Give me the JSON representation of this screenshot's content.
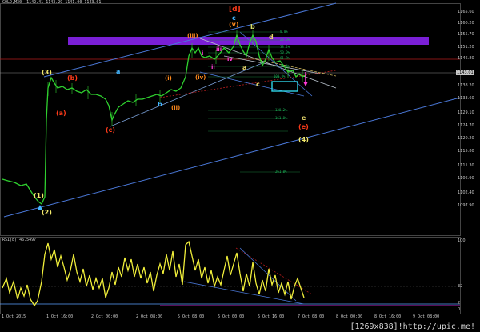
{
  "header": {
    "symbol": "GOLD,M30",
    "ohlc": "1142.41 1143.29 1141.00 1143.01"
  },
  "rsi_header": "RSI(8) 46.5497",
  "price_axis": [
    "1165.60",
    "1160.20",
    "1155.70",
    "1151.20",
    "1146.80",
    "1143.01",
    "1138.20",
    "1133.60",
    "1129.10",
    "1124.70",
    "1120.20",
    "1115.80",
    "1111.30",
    "1106.90",
    "1102.40",
    "1097.90"
  ],
  "rsi_axis": [
    "100",
    "32",
    "2",
    "0"
  ],
  "time_axis": [
    "1 Oct 2015",
    "1 Oct 16:00",
    "2 Oct 00:00",
    "2 Oct 08:00",
    "5 Oct 08:00",
    "6 Oct 00:00",
    "6 Oct 16:00",
    "7 Oct 08:00",
    "8 Oct 00:00",
    "8 Oct 16:00",
    "9 Oct 08:00"
  ],
  "waves": {
    "d_bracket": "[d]",
    "c_top": "c",
    "v": "(v)",
    "b_top": "b",
    "d": "d",
    "iii": "(iii)",
    "iii_sub": "iii",
    "i_sub": "i",
    "ii_sub": "ii",
    "iv_sub": "iv",
    "a_top": "a",
    "i_paren": "(i)",
    "iv_paren": "(iv)",
    "ii_paren": "(ii)",
    "b_blue": "b",
    "a_khaki": "a",
    "c_khaki": "c",
    "three": "(3)",
    "b_paren": "(b)",
    "a_paren": "(a)",
    "c_paren": "(c)",
    "e_khaki": "e",
    "e_red": "(e)",
    "four": "(4)",
    "one": "(1)",
    "two": "(2)",
    "a_blue": "a"
  },
  "fib_labels": [
    "0.0%",
    "23.6%",
    "38.2%",
    "50.0%",
    "61.8%",
    "76.4%",
    "100.0%",
    "138.2%",
    "161.8%",
    "261.8%"
  ],
  "watermark": "[1269x838]!http://upic.me!",
  "colors": {
    "bg": "#000000",
    "purple_zone": "#7a1fd6",
    "channel": "#4a78d8",
    "price": "#2fd02f",
    "rsi": "#f0ee3a"
  }
}
